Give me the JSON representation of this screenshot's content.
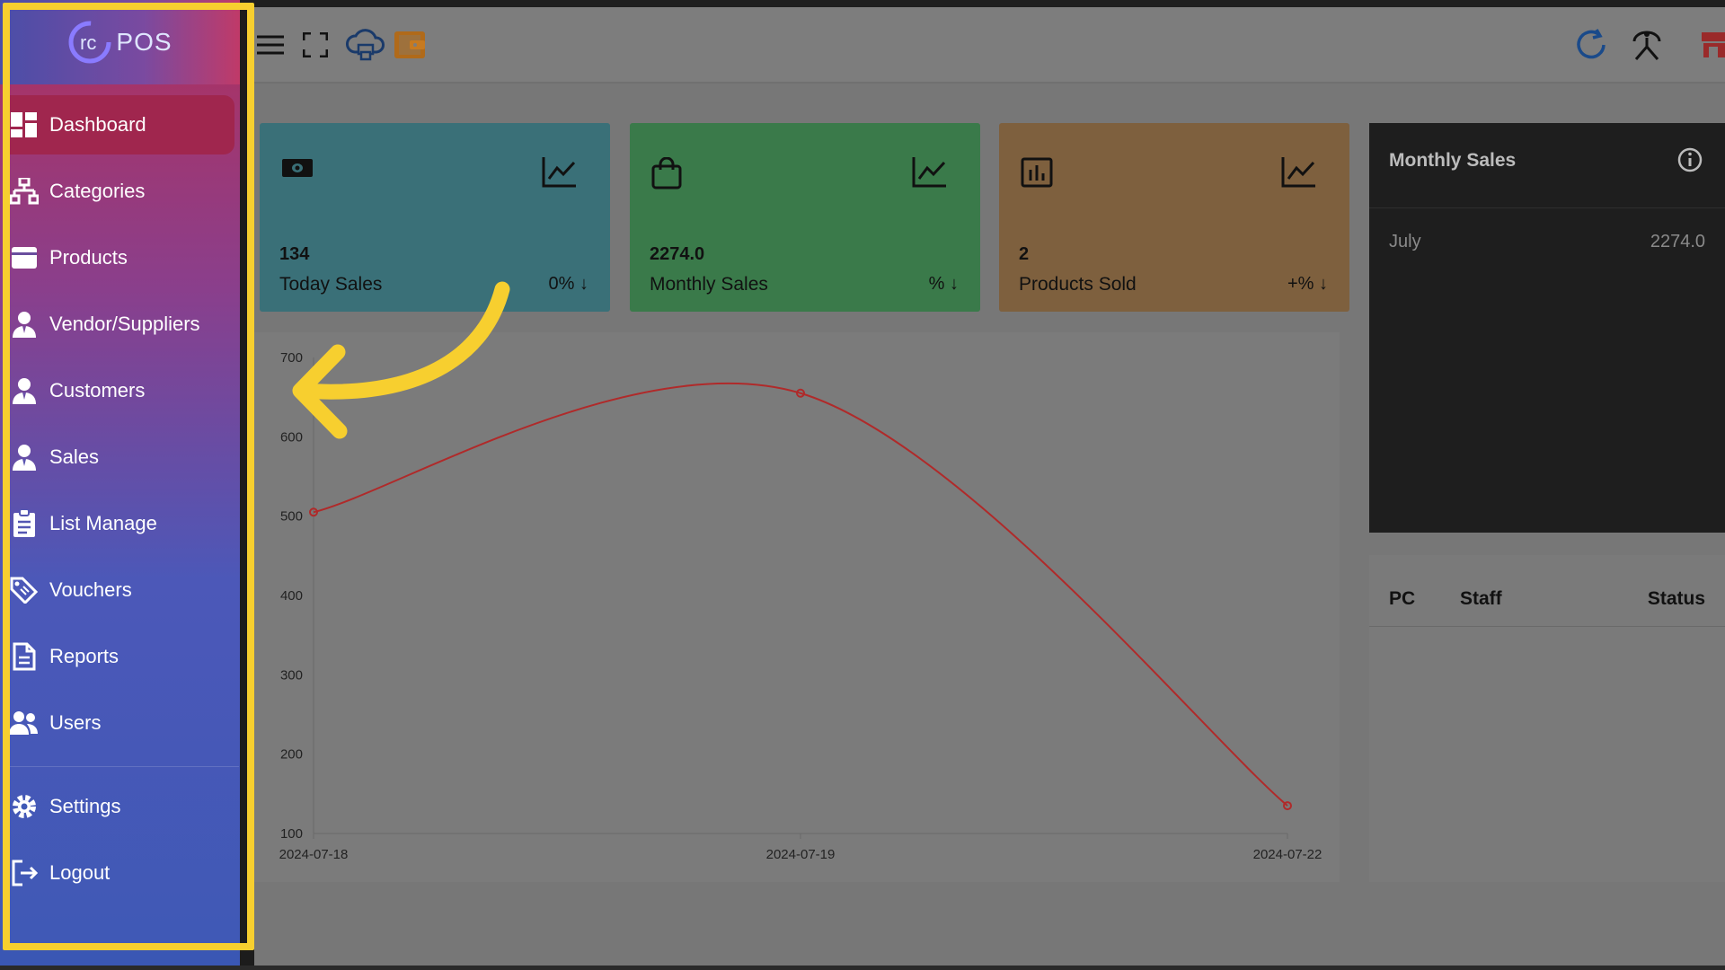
{
  "app": {
    "logo_text": "POS",
    "logo_mark": "rc"
  },
  "sidebar": {
    "items": [
      {
        "label": "Dashboard",
        "icon": "dashboard-icon",
        "active": true
      },
      {
        "label": "Categories",
        "icon": "sitemap-icon"
      },
      {
        "label": "Products",
        "icon": "product-box-icon"
      },
      {
        "label": "Vendor/Suppliers",
        "icon": "user-tie-icon"
      },
      {
        "label": "Customers",
        "icon": "user-tie-icon"
      },
      {
        "label": "Sales",
        "icon": "user-tie-icon"
      },
      {
        "label": "List Manage",
        "icon": "clipboard-list-icon"
      },
      {
        "label": "Vouchers",
        "icon": "tags-icon"
      },
      {
        "label": "Reports",
        "icon": "file-alt-icon"
      },
      {
        "label": "Users",
        "icon": "users-icon"
      },
      {
        "label": "Settings",
        "icon": "gear-icon"
      },
      {
        "label": "Logout",
        "icon": "logout-icon"
      }
    ]
  },
  "topbar": {
    "icons": [
      "menu-icon",
      "fullscreen-icon",
      "cloud-printer-icon",
      "wallet-icon",
      "refresh-icon",
      "sync-network-icon",
      "store-icon"
    ]
  },
  "cards": [
    {
      "value": "134",
      "label": "Today Sales",
      "pct": "0%",
      "color": "#3a7078",
      "icon": "money-icon"
    },
    {
      "value": "2274.0",
      "label": "Monthly Sales",
      "pct": "%",
      "color": "#3a7a4a",
      "icon": "shopping-bag-icon"
    },
    {
      "value": "2",
      "label": "Products Sold",
      "pct": "+%",
      "color": "#7e603e",
      "icon": "bar-chart-icon"
    }
  ],
  "monthly_sales": {
    "title": "Monthly Sales",
    "rows": [
      {
        "month": "July",
        "amount": "2274.0"
      }
    ]
  },
  "staff_table": {
    "headers": [
      "PC",
      "Staff",
      "Status"
    ]
  },
  "colors": {
    "highlight": "#f7cf2f",
    "line": "#b02a2a",
    "sidebar_active": "#a0264e"
  },
  "chart_data": {
    "type": "line",
    "x": [
      "2024-07-18",
      "2024-07-19",
      "2024-07-22"
    ],
    "series": [
      {
        "values": [
          505,
          655,
          135
        ]
      }
    ],
    "ylim": [
      100,
      700
    ],
    "yticks": [
      "700",
      "600",
      "500",
      "400",
      "300",
      "200",
      "100"
    ],
    "grid": false,
    "title": "",
    "xlabel": "",
    "ylabel": ""
  }
}
